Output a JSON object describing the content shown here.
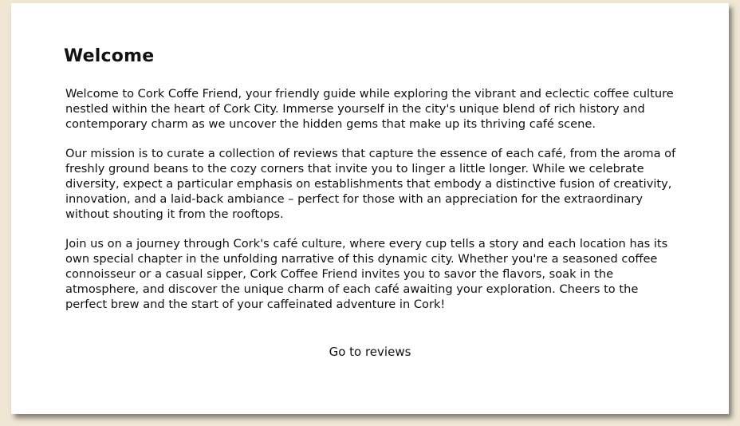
{
  "page": {
    "title": "Welcome",
    "paragraphs": [
      "Welcome to Cork Coffe Friend, your friendly guide while exploring the vibrant and eclectic coffee culture nestled within the heart of Cork City. Immerse yourself in the city's unique blend of rich history and contemporary charm as we uncover the hidden gems that make up its thriving café scene.",
      "Our mission is to curate a collection of reviews that capture the essence of each café, from the aroma of freshly ground beans to the cozy corners that invite you to linger a little longer. While we celebrate diversity, expect a particular emphasis on establishments that embody a distinctive fusion of creativity, innovation, and a laid-back ambiance – perfect for those with an appreciation for the extraordinary without shouting it from the rooftops.",
      "Join us on a journey through Cork's café culture, where every cup tells a story and each location has its own special chapter in the unfolding narrative of this dynamic city. Whether you're a seasoned coffee connoisseur or a casual sipper, Cork Coffee Friend invites you to savor the flavors, soak in the atmosphere, and discover the unique charm of each café awaiting your exploration. Cheers to the perfect brew and the start of your caffeinated adventure in Cork!"
    ],
    "link_label": "Go to reviews"
  },
  "colors": {
    "background": "#efe6d3",
    "card": "#ffffff",
    "text": "#111111"
  }
}
